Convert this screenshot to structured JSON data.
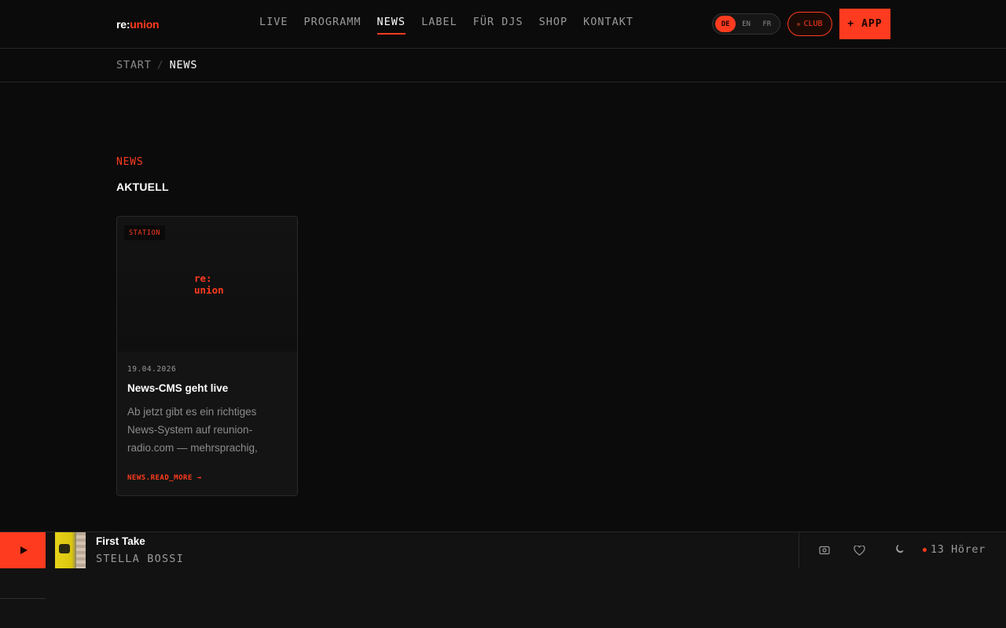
{
  "header": {
    "logo": {
      "re": "re:",
      "union": "union"
    },
    "nav": [
      {
        "label": "LIVE",
        "active": false
      },
      {
        "label": "PROGRAMM",
        "active": false
      },
      {
        "label": "NEWS",
        "active": true
      },
      {
        "label": "LABEL",
        "active": false
      },
      {
        "label": "FÜR DJS",
        "active": false
      },
      {
        "label": "SHOP",
        "active": false
      },
      {
        "label": "KONTAKT",
        "active": false
      }
    ],
    "languages": [
      {
        "code": "DE",
        "active": true
      },
      {
        "code": "EN",
        "active": false
      },
      {
        "code": "FR",
        "active": false
      }
    ],
    "club_label": "CLUB",
    "app_label": "+ APP"
  },
  "breadcrumb": {
    "home": "START",
    "separator": "/",
    "current": "NEWS"
  },
  "main": {
    "kicker": "NEWS",
    "title": "AKTUELL",
    "cards": [
      {
        "tag": "STATION",
        "logo_line1": "re:",
        "logo_line2": "union",
        "date": "19.04.2026",
        "title": "News-CMS geht live",
        "excerpt": "Ab jetzt gibt es ein richtiges News-System auf reunion-radio.com — mehrsprachig, RSS,...",
        "read_more": "NEWS.READ_MORE →"
      }
    ]
  },
  "player": {
    "track_title": "First Take",
    "artist": "STELLA BOSSI",
    "listeners": "13 Hörer",
    "progress": 0.045,
    "icons": [
      "screen-icon",
      "heart-icon",
      "moon-icon"
    ]
  },
  "colors": {
    "accent": "#ff3b1f",
    "background": "#0b0b0b",
    "surface": "#141414"
  }
}
